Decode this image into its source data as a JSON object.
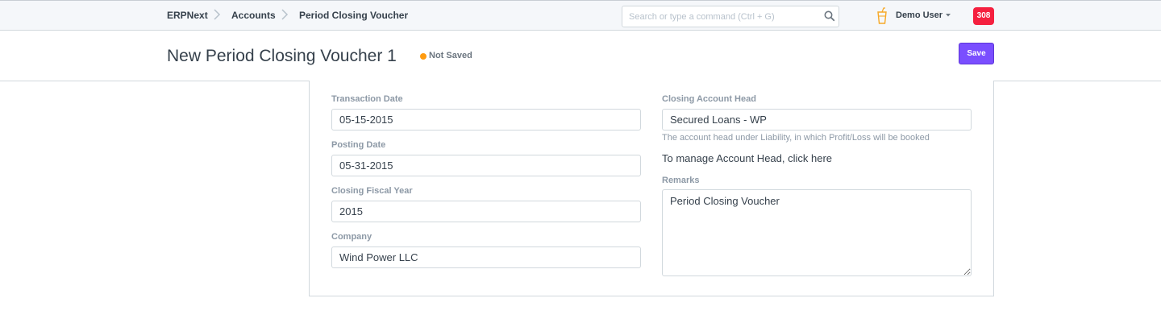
{
  "navbar": {
    "breadcrumbs": [
      "ERPNext",
      "Accounts",
      "Period Closing Voucher"
    ],
    "search_placeholder": "Search or type a command (Ctrl + G)",
    "user_name": "Demo User",
    "notification_count": "308",
    "icons": [
      "chevron-right-icon",
      "search-icon",
      "cup-icon",
      "caret-down-icon"
    ]
  },
  "page": {
    "title": "New Period Closing Voucher 1",
    "status": "Not Saved",
    "status_color": "#ff9b0f",
    "save_label": "Save",
    "primary_color": "#7a4eff"
  },
  "form": {
    "transaction_date": {
      "label": "Transaction Date",
      "value": "05-15-2015"
    },
    "posting_date": {
      "label": "Posting Date",
      "value": "05-31-2015"
    },
    "closing_fiscal_year": {
      "label": "Closing Fiscal Year",
      "value": "2015"
    },
    "company": {
      "label": "Company",
      "value": "Wind Power LLC"
    },
    "closing_account_head": {
      "label": "Closing Account Head",
      "value": "Secured Loans - WP",
      "help": "The account head under Liability, in which Profit/Loss will be booked"
    },
    "manage_link": "To manage Account Head, click here",
    "remarks": {
      "label": "Remarks",
      "value": "Period Closing Voucher"
    }
  }
}
